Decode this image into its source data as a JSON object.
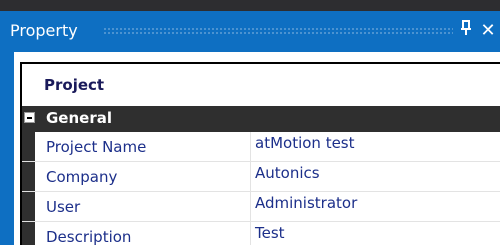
{
  "window": {
    "title": "Property",
    "pin_glyph": "1",
    "close_glyph": "✕"
  },
  "object": {
    "name": "Project"
  },
  "category": {
    "label": "General",
    "expanded": true
  },
  "properties": [
    {
      "name": "Project Name",
      "value": "atMotion test"
    },
    {
      "name": "Company",
      "value": "Autonics"
    },
    {
      "name": "User",
      "value": "Administrator"
    },
    {
      "name": "Description",
      "value": "Test"
    }
  ],
  "colors": {
    "titlebar": "#0e6fc2",
    "category_bg": "#2f2f2f",
    "text_blue": "#1c2f8a"
  }
}
